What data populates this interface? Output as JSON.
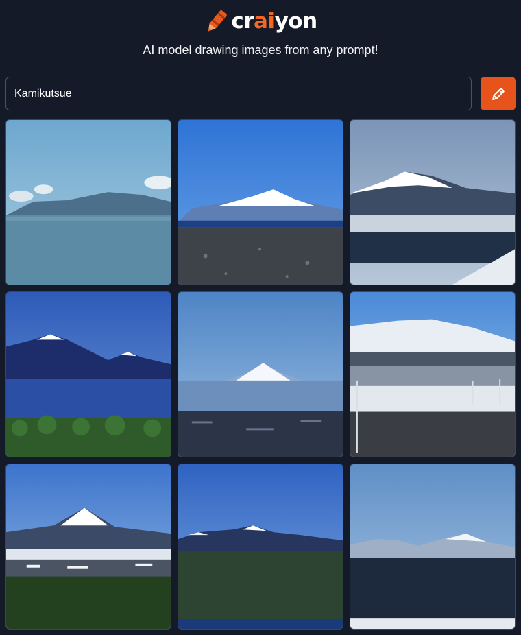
{
  "brand": {
    "name_part1": "cr",
    "name_part2": "ai",
    "name_part3": "yon",
    "accent_color": "#f26722",
    "logo_icon": "crayon-icon"
  },
  "tagline": "AI model drawing images from any prompt!",
  "prompt": {
    "value": "Kamikutsue",
    "button_icon": "pencil-icon",
    "button_color": "#e6541b"
  },
  "results": {
    "count": 9,
    "subject": "snow-capped volcano landscape"
  }
}
